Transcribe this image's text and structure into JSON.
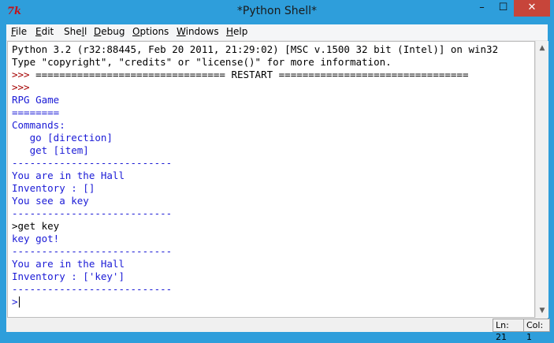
{
  "window": {
    "title": "*Python Shell*",
    "icon_glyph": "7k",
    "controls": {
      "minimize": "–",
      "maximize": "☐",
      "close": "✕"
    }
  },
  "menu": [
    {
      "key": "file",
      "accel": "F",
      "rest": "ile"
    },
    {
      "key": "edit",
      "accel": "E",
      "rest": "dit"
    },
    {
      "key": "shell",
      "pre": "She",
      "accel": "l",
      "rest": "l"
    },
    {
      "key": "debug",
      "accel": "D",
      "rest": "ebug"
    },
    {
      "key": "options",
      "accel": "O",
      "rest": "ptions"
    },
    {
      "key": "windows",
      "accel": "W",
      "rest": "indows"
    },
    {
      "key": "help",
      "accel": "H",
      "rest": "elp"
    }
  ],
  "colors": {
    "default": "#000000",
    "output": "#1a1ad6",
    "prompt": "#a40000",
    "separator": "#a40000"
  },
  "shell_lines": [
    {
      "text": "Python 3.2 (r32:88445, Feb 20 2011, 21:29:02) [MSC v.1500 32 bit (Intel)] on win32",
      "kind": "default"
    },
    {
      "text": "Type \"copyright\", \"credits\" or \"license()\" for more information.",
      "kind": "default"
    },
    {
      "text": ">>> ================================ RESTART ================================",
      "kind": "restart"
    },
    {
      "text": ">>> ",
      "kind": "prompt"
    },
    {
      "text": "RPG Game",
      "kind": "output"
    },
    {
      "text": "========",
      "kind": "output"
    },
    {
      "text": "Commands:",
      "kind": "output"
    },
    {
      "text": "   go [direction]",
      "kind": "output"
    },
    {
      "text": "   get [item]",
      "kind": "output"
    },
    {
      "text": "---------------------------",
      "kind": "output"
    },
    {
      "text": "You are in the Hall",
      "kind": "output"
    },
    {
      "text": "Inventory : []",
      "kind": "output"
    },
    {
      "text": "You see a key",
      "kind": "output"
    },
    {
      "text": "---------------------------",
      "kind": "output"
    },
    {
      "text": ">get key",
      "kind": "default"
    },
    {
      "text": "key got!",
      "kind": "output"
    },
    {
      "text": "---------------------------",
      "kind": "output"
    },
    {
      "text": "You are in the Hall",
      "kind": "output"
    },
    {
      "text": "Inventory : ['key']",
      "kind": "output"
    },
    {
      "text": "---------------------------",
      "kind": "output"
    },
    {
      "text": ">",
      "kind": "output"
    }
  ],
  "statusbar": {
    "line": "Ln: 21",
    "column": "Col: 1"
  }
}
